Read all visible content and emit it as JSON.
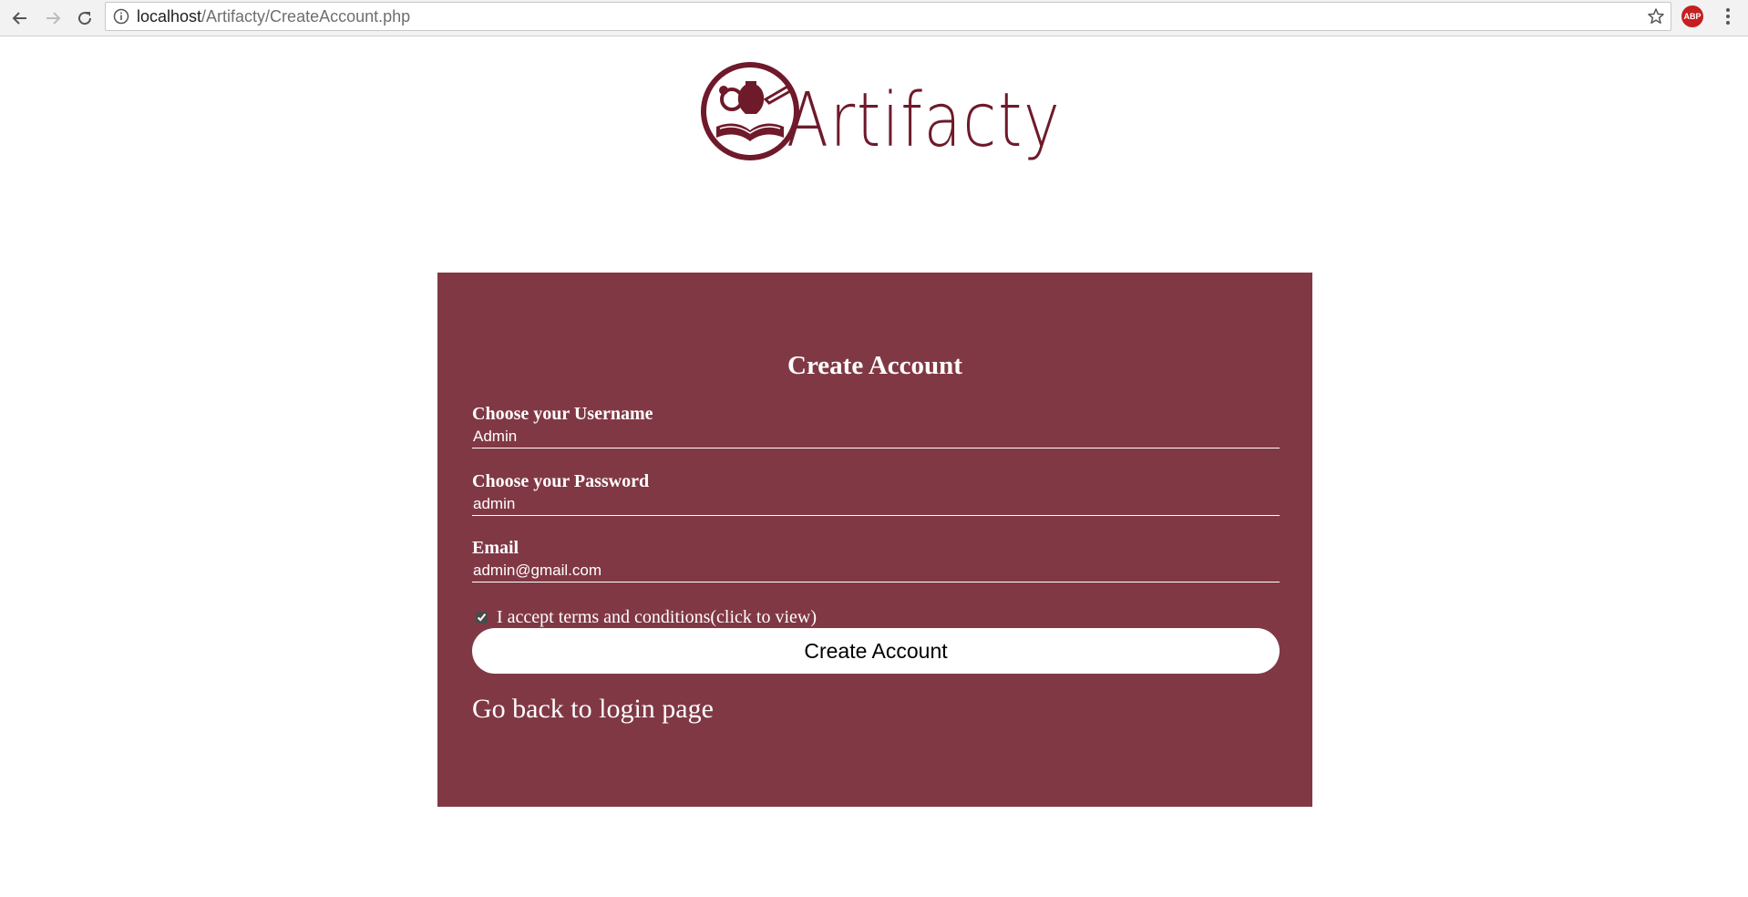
{
  "browser": {
    "url_host": "localhost",
    "url_path": "/Artifacty/CreateAccount.php",
    "extension_label": "ABP"
  },
  "logo": {
    "text": "Artifacty",
    "color": "#6e1a2a"
  },
  "form": {
    "title": "Create Account",
    "username": {
      "label": "Choose your Username",
      "value": "Admin"
    },
    "password": {
      "label": "Choose your Password",
      "value": "admin"
    },
    "email": {
      "label": "Email",
      "value": "admin@gmail.com"
    },
    "terms": {
      "label": "I accept terms and conditions(click to view)",
      "checked": true
    },
    "submit_label": "Create Account",
    "back_link": "Go back to login page",
    "panel_color": "#813845"
  },
  "icons": {
    "back": "back-arrow-icon",
    "forward": "forward-arrow-icon",
    "reload": "reload-icon",
    "info": "info-icon",
    "bookmark": "star-icon",
    "menu": "kebab-menu-icon"
  }
}
